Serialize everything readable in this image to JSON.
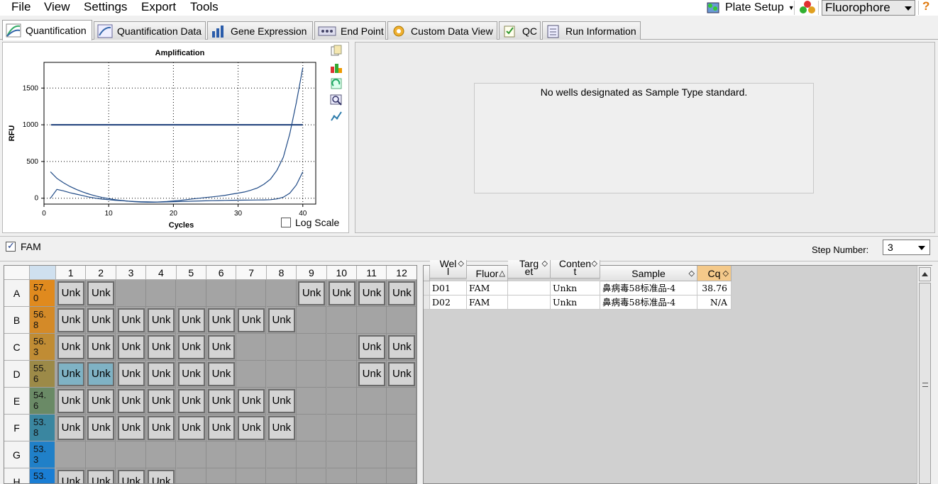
{
  "menu": [
    "File",
    "View",
    "Settings",
    "Export",
    "Tools"
  ],
  "toolbar": {
    "plate_setup": "Plate Setup",
    "fluorophore": "Fluorophore",
    "help": "?"
  },
  "tabs": [
    {
      "label": "Quantification",
      "icon": "quantification-icon",
      "active": true
    },
    {
      "label": "Quantification Data",
      "icon": "quant-data-icon"
    },
    {
      "label": "Gene Expression",
      "icon": "gene-expression-icon"
    },
    {
      "label": "End Point",
      "icon": "end-point-icon"
    },
    {
      "label": "Custom Data View",
      "icon": "custom-view-icon"
    },
    {
      "label": "QC",
      "icon": "qc-icon"
    },
    {
      "label": "Run Information",
      "icon": "run-info-icon"
    }
  ],
  "chart": {
    "log_scale_label": "Log Scale"
  },
  "chart_data": {
    "type": "line",
    "title": "Amplification",
    "xlabel": "Cycles",
    "ylabel": "RFU",
    "xlim": [
      0,
      42
    ],
    "ylim": [
      -80,
      1850
    ],
    "xticks": [
      0,
      10,
      20,
      30,
      40
    ],
    "yticks": [
      0,
      500,
      1000,
      1500
    ],
    "grid": true,
    "threshold": 1000,
    "series": [
      {
        "x": [
          1,
          2,
          3,
          4,
          5,
          6,
          7,
          8,
          9,
          10,
          11,
          12,
          13,
          14,
          15,
          16,
          17,
          18,
          19,
          20,
          21,
          22,
          23,
          24,
          25,
          26,
          27,
          28,
          29,
          30,
          31,
          32,
          33,
          34,
          35,
          36,
          37,
          38,
          39,
          40
        ],
        "values": [
          360,
          270,
          210,
          160,
          120,
          85,
          55,
          30,
          10,
          -5,
          -20,
          -30,
          -40,
          -48,
          -52,
          -55,
          -55,
          -50,
          -45,
          -38,
          -30,
          -20,
          -10,
          0,
          10,
          18,
          28,
          40,
          55,
          70,
          85,
          110,
          140,
          190,
          260,
          380,
          560,
          880,
          1300,
          1780
        ]
      },
      {
        "x": [
          1,
          2,
          3,
          4,
          5,
          6,
          7,
          8,
          9,
          10,
          11,
          12,
          13,
          14,
          15,
          16,
          17,
          18,
          19,
          20,
          21,
          22,
          23,
          24,
          25,
          26,
          27,
          28,
          29,
          30,
          31,
          32,
          33,
          34,
          35,
          36,
          37,
          38,
          39,
          40
        ],
        "values": [
          0,
          120,
          100,
          75,
          55,
          35,
          15,
          0,
          -12,
          -20,
          -28,
          -34,
          -40,
          -44,
          -48,
          -50,
          -52,
          -52,
          -50,
          -48,
          -45,
          -42,
          -40,
          -38,
          -36,
          -34,
          -32,
          -30,
          -28,
          -27,
          -26,
          -25,
          -24,
          -23,
          -20,
          -10,
          15,
          70,
          180,
          360
        ]
      }
    ]
  },
  "standard_msg": "No wells designated as Sample Type standard.",
  "fam_label": "FAM",
  "step_label": "Step Number:",
  "step_value": "3",
  "plate": {
    "columns": [
      "1",
      "2",
      "3",
      "4",
      "5",
      "6",
      "7",
      "8",
      "9",
      "10",
      "11",
      "12"
    ],
    "rows": [
      {
        "label": "A",
        "temp": "57.\n0",
        "color": "#e08a1e",
        "wells": [
          1,
          2,
          9,
          10,
          11,
          12
        ]
      },
      {
        "label": "B",
        "temp": "56.\n8",
        "color": "#d48a28",
        "wells": [
          1,
          2,
          3,
          4,
          5,
          6,
          7,
          8
        ]
      },
      {
        "label": "C",
        "temp": "56.\n3",
        "color": "#c08c34",
        "wells": [
          1,
          2,
          3,
          4,
          5,
          6,
          11,
          12
        ]
      },
      {
        "label": "D",
        "temp": "55.\n6",
        "color": "#9c8a48",
        "wells": [
          1,
          2,
          3,
          4,
          5,
          6,
          11,
          12
        ],
        "selected": [
          1,
          2
        ]
      },
      {
        "label": "E",
        "temp": "54.\n6",
        "color": "#6a8a66",
        "wells": [
          1,
          2,
          3,
          4,
          5,
          6,
          7,
          8
        ]
      },
      {
        "label": "F",
        "temp": "53.\n8",
        "color": "#3a86a0",
        "wells": [
          1,
          2,
          3,
          4,
          5,
          6,
          7,
          8
        ]
      },
      {
        "label": "G",
        "temp": "53.\n3",
        "color": "#2080c8",
        "wells": []
      },
      {
        "label": "H",
        "temp": "53.",
        "color": "#1a7ed4",
        "wells": [
          1,
          2,
          3,
          4
        ]
      }
    ],
    "well_label": "Unk"
  },
  "results": {
    "headers": [
      "Wel\nl",
      "Fluor",
      "Targ\net",
      "Conten\nt",
      "Sample",
      "Cq"
    ],
    "rows": [
      [
        "D01",
        "FAM",
        "",
        "Unkn",
        "鼻病毒58标准品-4",
        "38.76"
      ],
      [
        "D02",
        "FAM",
        "",
        "Unkn",
        "鼻病毒58标准品-4",
        "N/A"
      ]
    ]
  }
}
